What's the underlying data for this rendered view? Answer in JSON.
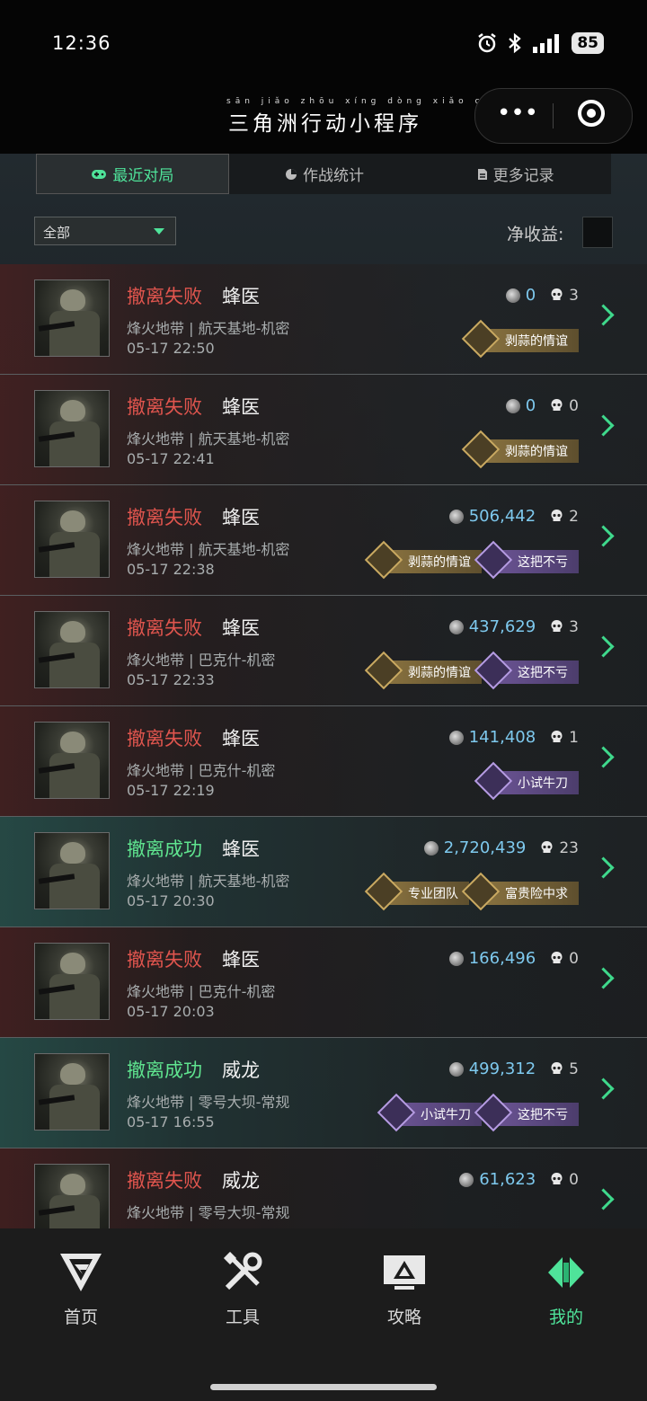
{
  "status": {
    "time": "12:36",
    "battery": "85"
  },
  "header": {
    "pinyin": "sān jiǎo zhōu xíng dòng xiǎo chéng xù",
    "title": "三角洲行动小程序"
  },
  "tabs": [
    {
      "label": "最近对局",
      "icon": "gamepad-icon"
    },
    {
      "label": "作战统计",
      "icon": "pie-chart-icon"
    },
    {
      "label": "更多记录",
      "icon": "document-icon"
    }
  ],
  "filter": {
    "value": "全部"
  },
  "net_income": {
    "label": "净收益:"
  },
  "matches": [
    {
      "result": "撤离失败",
      "role": "蜂医",
      "map": "烽火地带 | 航天基地-机密",
      "time": "05-17 22:50",
      "money": "0",
      "kills": "3",
      "badges": [
        "剥蒜的情谊"
      ]
    },
    {
      "result": "撤离失败",
      "role": "蜂医",
      "map": "烽火地带 | 航天基地-机密",
      "time": "05-17 22:41",
      "money": "0",
      "kills": "0",
      "badges": [
        "剥蒜的情谊"
      ]
    },
    {
      "result": "撤离失败",
      "role": "蜂医",
      "map": "烽火地带 | 航天基地-机密",
      "time": "05-17 22:38",
      "money": "506,442",
      "kills": "2",
      "badges": [
        "剥蒜的情谊",
        "这把不亏"
      ]
    },
    {
      "result": "撤离失败",
      "role": "蜂医",
      "map": "烽火地带 | 巴克什-机密",
      "time": "05-17 22:33",
      "money": "437,629",
      "kills": "3",
      "badges": [
        "剥蒜的情谊",
        "这把不亏"
      ]
    },
    {
      "result": "撤离失败",
      "role": "蜂医",
      "map": "烽火地带 | 巴克什-机密",
      "time": "05-17 22:19",
      "money": "141,408",
      "kills": "1",
      "badges": [
        "小试牛刀"
      ]
    },
    {
      "result": "撤离成功",
      "role": "蜂医",
      "map": "烽火地带 | 航天基地-机密",
      "time": "05-17 20:30",
      "money": "2,720,439",
      "kills": "23",
      "badges": [
        "专业团队",
        "富贵险中求"
      ]
    },
    {
      "result": "撤离失败",
      "role": "蜂医",
      "map": "烽火地带 | 巴克什-机密",
      "time": "05-17 20:03",
      "money": "166,496",
      "kills": "0",
      "badges": []
    },
    {
      "result": "撤离成功",
      "role": "威龙",
      "map": "烽火地带 | 零号大坝-常规",
      "time": "05-17 16:55",
      "money": "499,312",
      "kills": "5",
      "badges": [
        "小试牛刀",
        "这把不亏"
      ]
    },
    {
      "result": "撤离失败",
      "role": "威龙",
      "map": "烽火地带 | 零号大坝-常规",
      "time": "",
      "money": "61,623",
      "kills": "0",
      "badges": []
    }
  ],
  "tabbar": [
    {
      "label": "首页",
      "icon": "home-logo-icon"
    },
    {
      "label": "工具",
      "icon": "tools-icon"
    },
    {
      "label": "攻略",
      "icon": "guide-monitor-icon"
    },
    {
      "label": "我的",
      "icon": "profile-logo-icon",
      "active": true
    }
  ],
  "colors": {
    "accent": "#4fe39a",
    "fail": "#e0554e",
    "success": "#5fe48f",
    "money": "#7ec9ee"
  }
}
